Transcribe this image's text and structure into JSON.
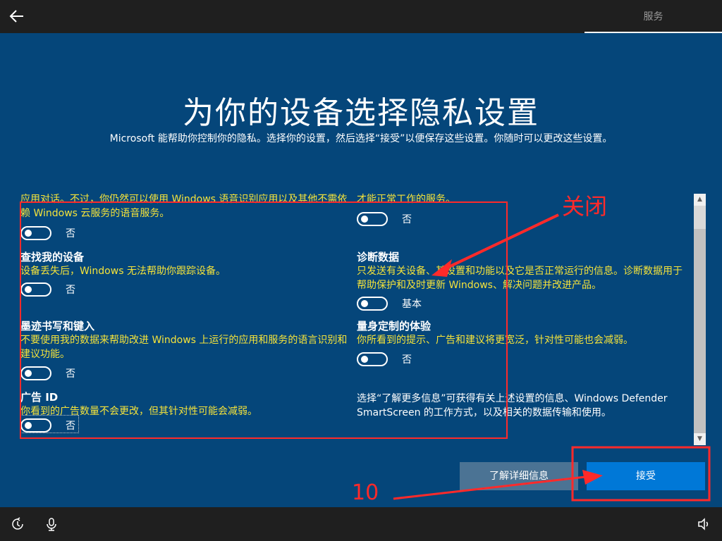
{
  "header": {
    "tab_label": "服务"
  },
  "page": {
    "title": "为你的设备选择隐私设置",
    "subtitle": "Microsoft 能帮助你控制你的隐私。选择你的设置，然后选择“接受”以便保存这些设置。你随时可以更改这些设置。"
  },
  "left_settings": [
    {
      "title": "",
      "description": "应用对话。不过，你仍然可以使用 Windows 语音识别应用以及其他不需依赖 Windows 云服务的语音服务。",
      "state": "否"
    },
    {
      "title": "查找我的设备",
      "description": "设备丢失后，Windows 无法帮助你跟踪设备。",
      "state": "否"
    },
    {
      "title": "墨迹书写和键入",
      "description": "不要使用我的数据来帮助改进 Windows 上运行的应用和服务的语言识别和建议功能。",
      "state": "否"
    },
    {
      "title": "广告 ID",
      "description": "你看到的广告数量不会更改，但其针对性可能会减弱。",
      "state": "否"
    }
  ],
  "right_settings": [
    {
      "title": "",
      "description": "才能正常工作的服务。",
      "state": "否"
    },
    {
      "title": "诊断数据",
      "description": "只发送有关设备、其设置和功能以及它是否正常运行的信息。诊断数据用于帮助保护和及时更新 Windows、解决问题并改进产品。",
      "state": "基本"
    },
    {
      "title": "量身定制的体验",
      "description": "你所看到的提示、广告和建议将更宽泛，针对性可能也会减弱。",
      "state": "否"
    }
  ],
  "info_text": "选择“了解更多信息”可获得有关上述设置的信息、Windows Defender SmartScreen 的工作方式，以及相关的数据传输和使用。",
  "buttons": {
    "learn_more": "了解详细信息",
    "accept": "接受"
  },
  "annotations": {
    "close_label": "关闭",
    "step_number": "10",
    "color": "#ff2a2a"
  },
  "colors": {
    "background": "#05467a",
    "description_text": "#f5e33a",
    "accept_button": "#0078d7",
    "learn_more_button": "#4b7394"
  },
  "icons": {
    "back": "back-arrow-icon",
    "ease_of_access": "ease-of-access-icon",
    "microphone": "microphone-icon",
    "volume": "volume-icon"
  }
}
